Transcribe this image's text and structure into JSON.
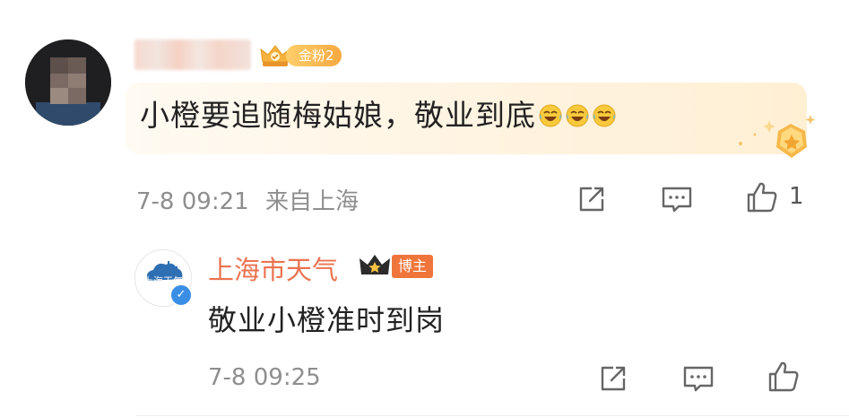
{
  "comment": {
    "fan_badge_label": "金粉2",
    "text": "小橙要追随梅姑娘，敬业到底",
    "emojis": [
      "laugh-cry-emoji",
      "laugh-cry-emoji",
      "laugh-cry-emoji"
    ],
    "time": "7-8 09:21",
    "source": "来自上海",
    "like_count": "1"
  },
  "reply": {
    "author_name": "上海市天气",
    "author_badge": "博主",
    "avatar_text": "上海天气",
    "text": "敬业小橙准时到岗",
    "time": "7-8 09:25"
  },
  "colors": {
    "name_accent": "#eb7350",
    "badge_gold": "#f7a941",
    "verified_blue": "#3a8ee6",
    "meta_gray": "#8e8e8e"
  },
  "icons": [
    "share-icon",
    "comment-icon",
    "like-icon",
    "crown-icon",
    "verified-icon",
    "fan-badge-crown-icon"
  ]
}
